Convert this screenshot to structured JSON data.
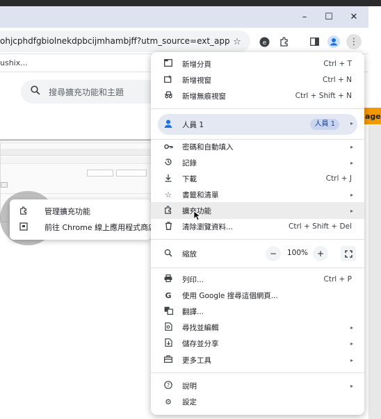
{
  "window": {
    "minimize_glyph": "–",
    "maximize_glyph": "☐",
    "close_glyph": "✕"
  },
  "toolbar": {
    "url": "ohjcphdfgbiolnekdpbcijmhambjff?utm_source=ext_app_menu",
    "bookmark_text": "ushix..."
  },
  "page": {
    "search_placeholder": "搜尋擴充功能和主題",
    "popup_items": [
      {
        "label": "管理擴充功能"
      },
      {
        "label": "前往 Chrome 線上應用程式商店"
      }
    ],
    "side_tag": "age"
  },
  "menu": {
    "items": [
      {
        "label": "新增分頁",
        "shortcut": "Ctrl + T",
        "icon": "new-tab-icon"
      },
      {
        "label": "新增視窗",
        "shortcut": "Ctrl + N",
        "icon": "new-window-icon"
      },
      {
        "label": "新增無痕視窗",
        "shortcut": "Ctrl + Shift + N",
        "icon": "incognito-icon"
      }
    ],
    "profile": {
      "label": "人員 1",
      "badge": "人員 1"
    },
    "group2": [
      {
        "label": "密碼和自動填入",
        "icon": "key-icon"
      },
      {
        "label": "記錄",
        "icon": "history-icon"
      },
      {
        "label": "下載",
        "shortcut": "Ctrl + J",
        "icon": "download-icon"
      },
      {
        "label": "書籤和清單",
        "icon": "star-icon"
      },
      {
        "label": "擴充功能",
        "icon": "puzzle-icon"
      },
      {
        "label": "清除瀏覽資料...",
        "shortcut": "Ctrl + Shift + Del",
        "icon": "trash-icon"
      }
    ],
    "zoom": {
      "label": "縮放",
      "minus": "−",
      "value": "100%",
      "plus": "+"
    },
    "group4": [
      {
        "label": "列印...",
        "shortcut": "Ctrl + P",
        "icon": "print-icon"
      },
      {
        "label": "使用 Google 搜尋這個網頁...",
        "icon": "google-icon"
      },
      {
        "label": "翻譯...",
        "icon": "translate-icon"
      },
      {
        "label": "尋找並編輯",
        "icon": "find-icon"
      },
      {
        "label": "儲存並分享",
        "icon": "save-share-icon"
      },
      {
        "label": "更多工具",
        "icon": "toolbox-icon"
      }
    ],
    "group5": [
      {
        "label": "說明",
        "icon": "help-icon"
      },
      {
        "label": "設定",
        "icon": "settings-icon"
      }
    ]
  }
}
